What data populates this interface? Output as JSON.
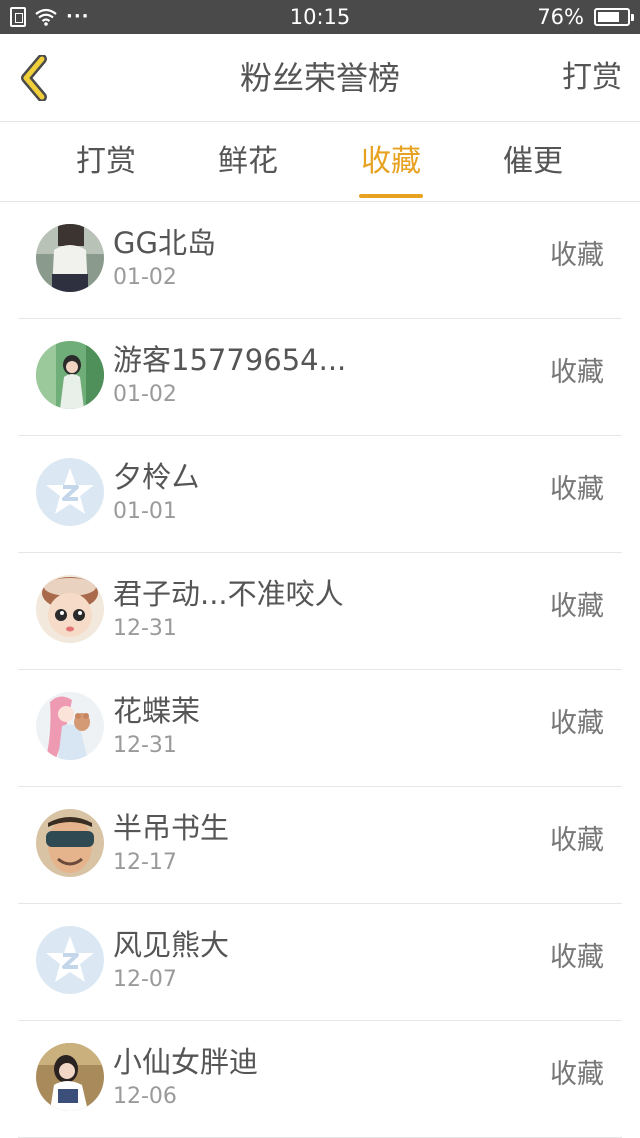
{
  "status_bar": {
    "time": "10:15",
    "battery_percent": "76%",
    "battery_level": 0.76,
    "icons": [
      "sim-icon",
      "wifi-icon",
      "more-dots-icon",
      "battery-icon"
    ],
    "dots": "···"
  },
  "header": {
    "back_icon": "chevron-left-icon",
    "title": "粉丝荣誉榜",
    "right_action": "打赏"
  },
  "colors": {
    "accent": "#e8a221",
    "back_icon_fill": "#f0cf3a"
  },
  "tabs": [
    {
      "label": "打赏",
      "active": false
    },
    {
      "label": "鲜花",
      "active": false
    },
    {
      "label": "收藏",
      "active": true
    },
    {
      "label": "催更",
      "active": false
    }
  ],
  "list": [
    {
      "name": "GG北岛",
      "date": "01-02",
      "action": "收藏",
      "avatar": "photo-avatar"
    },
    {
      "name": "游客15779654...",
      "date": "01-02",
      "action": "收藏",
      "avatar": "photo-avatar"
    },
    {
      "name": "夕柃厶",
      "date": "01-01",
      "action": "收藏",
      "avatar": "default-star-avatar"
    },
    {
      "name": "君子动...不准咬人",
      "date": "12-31",
      "action": "收藏",
      "avatar": "photo-avatar"
    },
    {
      "name": "花蝶茉",
      "date": "12-31",
      "action": "收藏",
      "avatar": "photo-avatar"
    },
    {
      "name": "半吊书生",
      "date": "12-17",
      "action": "收藏",
      "avatar": "photo-avatar"
    },
    {
      "name": "风见熊大",
      "date": "12-07",
      "action": "收藏",
      "avatar": "default-star-avatar"
    },
    {
      "name": "小仙女胖迪",
      "date": "12-06",
      "action": "收藏",
      "avatar": "photo-avatar"
    }
  ]
}
